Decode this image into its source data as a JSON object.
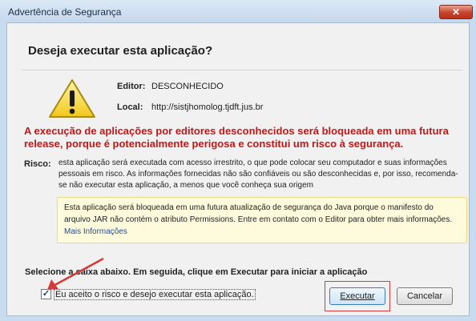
{
  "window": {
    "title": "Advertência de Segurança",
    "close_icon": "close-icon"
  },
  "dialog": {
    "heading": "Deseja executar esta aplicação?",
    "icon": "warning-triangle-icon",
    "editor": {
      "label": "Editor:",
      "value": "DESCONHECIDO"
    },
    "location": {
      "label": "Local:",
      "value": "http://sistjhomolog.tjdft.jus.br"
    },
    "red_warning": "A execução de aplicações por editores desconhecidos será bloqueada em uma futura release, porque é potencialmente perigosa e constitui um risco à segurança.",
    "risk": {
      "label": "Risco:",
      "text": "esta aplicação será executada com acesso irrestrito, o que pode colocar seu computador e suas informações pessoais em risco. As informações fornecidas não são confiáveis ou são desconhecidas e, por isso, recomenda-se não executar esta aplicação, a menos que você conheça sua origem"
    },
    "notice": {
      "text": "Esta aplicação será bloqueada em uma futura atualização de segurança do Java porque o manifesto do arquivo JAR não contém o atributo Permissions. Entre em contato com o Editor para obter mais informações.",
      "link": "Mais Informações"
    },
    "select_instruction": "Selecione a caixa abaixo. Em seguida, clique em Executar para iniciar a aplicação",
    "checkbox": {
      "label": "Eu aceito o risco e desejo executar esta aplicação.",
      "checked": true
    },
    "buttons": {
      "execute": "Executar",
      "cancel": "Cancelar"
    }
  },
  "colors": {
    "warning_red": "#c21717",
    "annotation_red": "#d43a3a",
    "link_blue": "#1a4fa8"
  }
}
